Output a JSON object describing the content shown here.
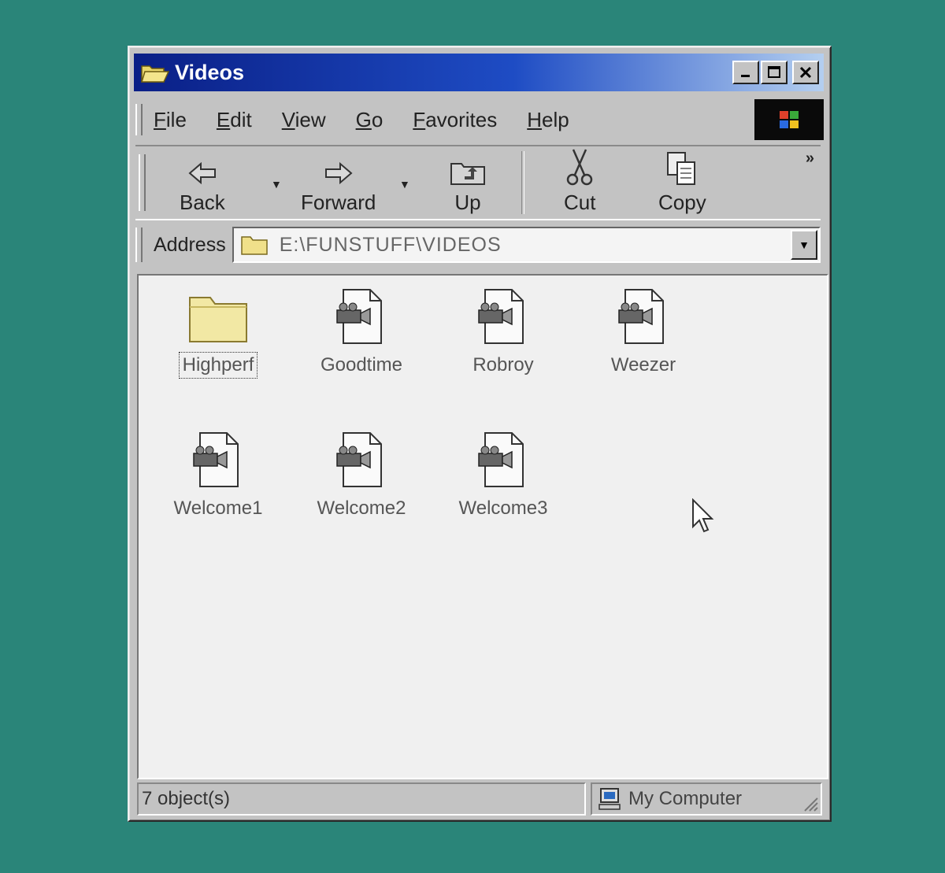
{
  "window": {
    "title": "Videos"
  },
  "menu": [
    "File",
    "Edit",
    "View",
    "Go",
    "Favorites",
    "Help"
  ],
  "toolbar": {
    "back": "Back",
    "forward": "Forward",
    "up": "Up",
    "cut": "Cut",
    "copy": "Copy",
    "more": "»"
  },
  "address": {
    "label": "Address",
    "value": "E:\\FUNSTUFF\\VIDEOS"
  },
  "items": [
    {
      "name": "Highperf",
      "type": "folder"
    },
    {
      "name": "Goodtime",
      "type": "video-file"
    },
    {
      "name": "Robroy",
      "type": "video-file"
    },
    {
      "name": "Weezer",
      "type": "video-file"
    },
    {
      "name": "Welcome1",
      "type": "video-file"
    },
    {
      "name": "Welcome2",
      "type": "video-file"
    },
    {
      "name": "Welcome3",
      "type": "video-file"
    }
  ],
  "status": {
    "objects": "7 object(s)",
    "zone": "My Computer"
  },
  "colors": {
    "desktop": "#2a8579",
    "titlebar": "#0a1f86",
    "window": "#c3c3c3"
  }
}
